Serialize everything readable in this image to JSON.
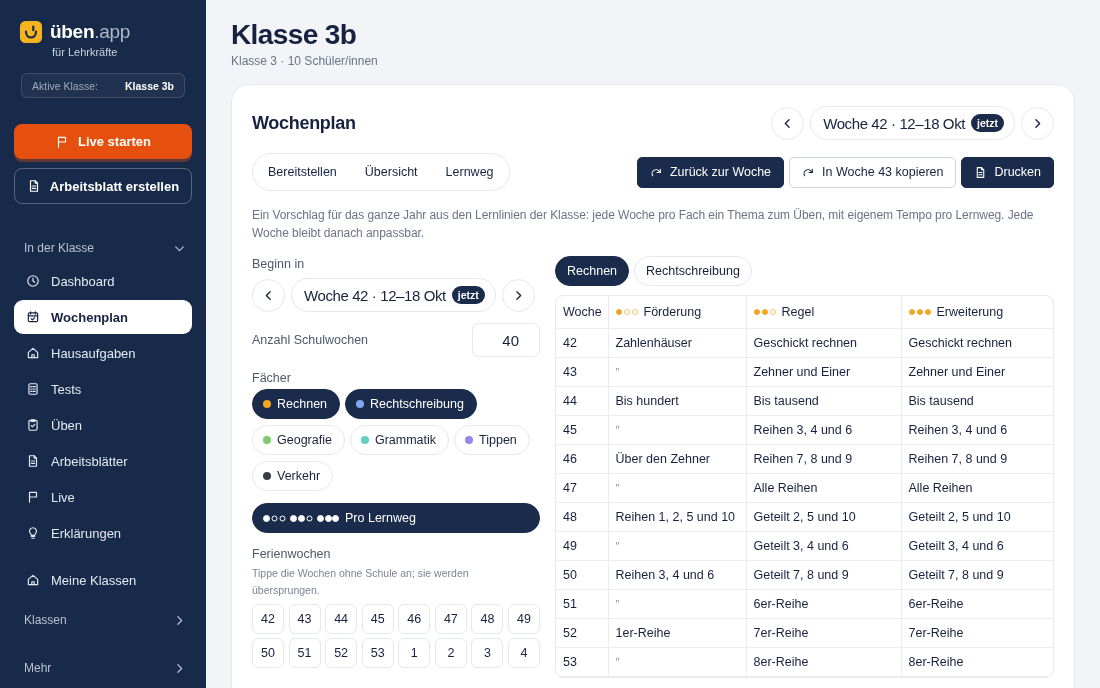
{
  "page": {
    "title": "Klasse 3b",
    "subtitle": "Klasse 3 · 10 Schüler/innen"
  },
  "sidebar": {
    "brand": "**üben**.app",
    "tagline": "für Lehrkräfte",
    "active_class": {
      "label": "Aktive Klasse:",
      "value": "Klasse 3b"
    },
    "actions": [
      {
        "label": "Live starten",
        "kind": "primary"
      },
      {
        "label": "Arbeitsblatt erstellen",
        "kind": "outline"
      }
    ],
    "nav": [
      {
        "kind": "section",
        "title": "In der Klasse",
        "expanded": true,
        "items": [
          {
            "label": "Dashboard",
            "selected": false
          },
          {
            "label": "Wochenplan",
            "selected": true
          },
          {
            "label": "Hausaufgaben",
            "selected": false
          },
          {
            "label": "Tests",
            "selected": false
          },
          {
            "label": "Üben",
            "selected": false
          },
          {
            "label": "Arbeitsblätter",
            "selected": false
          },
          {
            "label": "Live",
            "selected": false
          },
          {
            "label": "Erklärungen",
            "selected": false
          }
        ]
      },
      {
        "kind": "link",
        "label": "Meine Klassen",
        "selected": false
      },
      {
        "kind": "section",
        "title": "Klassen",
        "expanded": false
      },
      {
        "kind": "section",
        "title": "Mehr",
        "expanded": false
      }
    ]
  },
  "plan": {
    "title": "Wochenplan",
    "week_nav": {
      "label": "Woche 42 · 12–18 Okt",
      "badge": "jetzt"
    },
    "tabs": [
      {
        "label": "Bereitstellen",
        "selected": false
      },
      {
        "label": "Übersicht",
        "selected": false
      },
      {
        "label": "Lernweg",
        "selected": false
      }
    ],
    "actions": [
      {
        "label": "Zurück zur Woche",
        "kind": "primary"
      },
      {
        "label": "In Woche 43 kopieren",
        "kind": "outline"
      },
      {
        "label": "Drucken",
        "kind": "primary"
      }
    ],
    "description": "Ein Vorschlag für das ganze Jahr aus den Lernlinien der Klasse: jede Woche pro Fach ein Thema zum Üben, mit eigenem Tempo pro Lernweg. Jede Woche bleibt danach anpassbar.",
    "settings": {
      "start": {
        "label": "Beginn in",
        "week_nav": {
          "label": "Woche 42 · 12–18 Okt",
          "badge": "jetzt"
        }
      },
      "weeks_count": {
        "label": "Anzahl Schulwochen",
        "value": "40"
      },
      "subjects": {
        "label": "Fächer",
        "items": [
          {
            "label": "Rechnen",
            "color": "#f5a524",
            "selected": true
          },
          {
            "label": "Rechtschreibung",
            "color": "#7ea6ee",
            "selected": true
          },
          {
            "label": "Geografie",
            "color": "#7dc96e",
            "selected": false
          },
          {
            "label": "Grammatik",
            "color": "#5fcfc6",
            "selected": false
          },
          {
            "label": "Tippen",
            "color": "#9a86ea",
            "selected": false
          },
          {
            "label": "Verkehr",
            "color": "#3a3d44",
            "selected": false
          }
        ]
      },
      "pace_toggle": {
        "label": "Pro Lernweg",
        "on": true
      },
      "holidays": {
        "label": "Ferienwochen",
        "hint": "Tippe die Wochen ohne Schule an; sie werden übersprungen.",
        "weeks": [
          {
            "label": "42",
            "selected": false
          },
          {
            "label": "43",
            "selected": false
          },
          {
            "label": "44",
            "selected": false
          },
          {
            "label": "45",
            "selected": false
          },
          {
            "label": "46",
            "selected": false
          },
          {
            "label": "47",
            "selected": false
          },
          {
            "label": "48",
            "selected": false
          },
          {
            "label": "49",
            "selected": false
          },
          {
            "label": "50",
            "selected": false
          },
          {
            "label": "51",
            "selected": false
          },
          {
            "label": "52",
            "selected": false
          },
          {
            "label": "53",
            "selected": false
          },
          {
            "label": "1",
            "selected": false
          },
          {
            "label": "2",
            "selected": false
          },
          {
            "label": "3",
            "selected": false
          },
          {
            "label": "4",
            "selected": false
          }
        ]
      }
    },
    "schedule": {
      "subject_tabs": [
        {
          "label": "Rechnen",
          "selected": true
        },
        {
          "label": "Rechtschreibung",
          "selected": false
        }
      ],
      "columns": [
        {
          "label": "Woche"
        },
        {
          "label": "Förderung",
          "stars": 1
        },
        {
          "label": "Regel",
          "stars": 2
        },
        {
          "label": "Erweiterung",
          "stars": 3
        }
      ],
      "rows": [
        {
          "cells": [
            {
              "text": "42",
              "ditto": false
            },
            {
              "text": "Zahlenhäuser",
              "ditto": false
            },
            {
              "text": "Geschickt rechnen",
              "ditto": false
            },
            {
              "text": "Geschickt rechnen",
              "ditto": false
            }
          ]
        },
        {
          "cells": [
            {
              "text": "43",
              "ditto": false
            },
            {
              "text": "″",
              "ditto": true
            },
            {
              "text": "Zehner und Einer",
              "ditto": false
            },
            {
              "text": "Zehner und Einer",
              "ditto": false
            }
          ]
        },
        {
          "cells": [
            {
              "text": "44",
              "ditto": false
            },
            {
              "text": "Bis hundert",
              "ditto": false
            },
            {
              "text": "Bis tausend",
              "ditto": false
            },
            {
              "text": "Bis tausend",
              "ditto": false
            }
          ]
        },
        {
          "cells": [
            {
              "text": "45",
              "ditto": false
            },
            {
              "text": "″",
              "ditto": true
            },
            {
              "text": "Reihen 3, 4 und 6",
              "ditto": false
            },
            {
              "text": "Reihen 3, 4 und 6",
              "ditto": false
            }
          ]
        },
        {
          "cells": [
            {
              "text": "46",
              "ditto": false
            },
            {
              "text": "Über den Zehner",
              "ditto": false
            },
            {
              "text": "Reihen 7, 8 und 9",
              "ditto": false
            },
            {
              "text": "Reihen 7, 8 und 9",
              "ditto": false
            }
          ]
        },
        {
          "cells": [
            {
              "text": "47",
              "ditto": false
            },
            {
              "text": "″",
              "ditto": true
            },
            {
              "text": "Alle Reihen",
              "ditto": false
            },
            {
              "text": "Alle Reihen",
              "ditto": false
            }
          ]
        },
        {
          "cells": [
            {
              "text": "48",
              "ditto": false
            },
            {
              "text": "Reihen 1, 2, 5 und 10",
              "ditto": false
            },
            {
              "text": "Geteilt 2, 5 und 10",
              "ditto": false
            },
            {
              "text": "Geteilt 2, 5 und 10",
              "ditto": false
            }
          ]
        },
        {
          "cells": [
            {
              "text": "49",
              "ditto": false
            },
            {
              "text": "″",
              "ditto": true
            },
            {
              "text": "Geteilt 3, 4 und 6",
              "ditto": false
            },
            {
              "text": "Geteilt 3, 4 und 6",
              "ditto": false
            }
          ]
        },
        {
          "cells": [
            {
              "text": "50",
              "ditto": false
            },
            {
              "text": "Reihen 3, 4 und 6",
              "ditto": false
            },
            {
              "text": "Geteilt 7, 8 und 9",
              "ditto": false
            },
            {
              "text": "Geteilt 7, 8 und 9",
              "ditto": false
            }
          ]
        },
        {
          "cells": [
            {
              "text": "51",
              "ditto": false
            },
            {
              "text": "″",
              "ditto": true
            },
            {
              "text": "6er-Reihe",
              "ditto": false
            },
            {
              "text": "6er-Reihe",
              "ditto": false
            }
          ]
        },
        {
          "cells": [
            {
              "text": "52",
              "ditto": false
            },
            {
              "text": "1er-Reihe",
              "ditto": false
            },
            {
              "text": "7er-Reihe",
              "ditto": false
            },
            {
              "text": "7er-Reihe",
              "ditto": false
            }
          ]
        },
        {
          "cells": [
            {
              "text": "53",
              "ditto": false
            },
            {
              "text": "″",
              "ditto": true
            },
            {
              "text": "8er-Reihe",
              "ditto": false
            },
            {
              "text": "8er-Reihe",
              "ditto": false
            }
          ]
        }
      ]
    }
  }
}
